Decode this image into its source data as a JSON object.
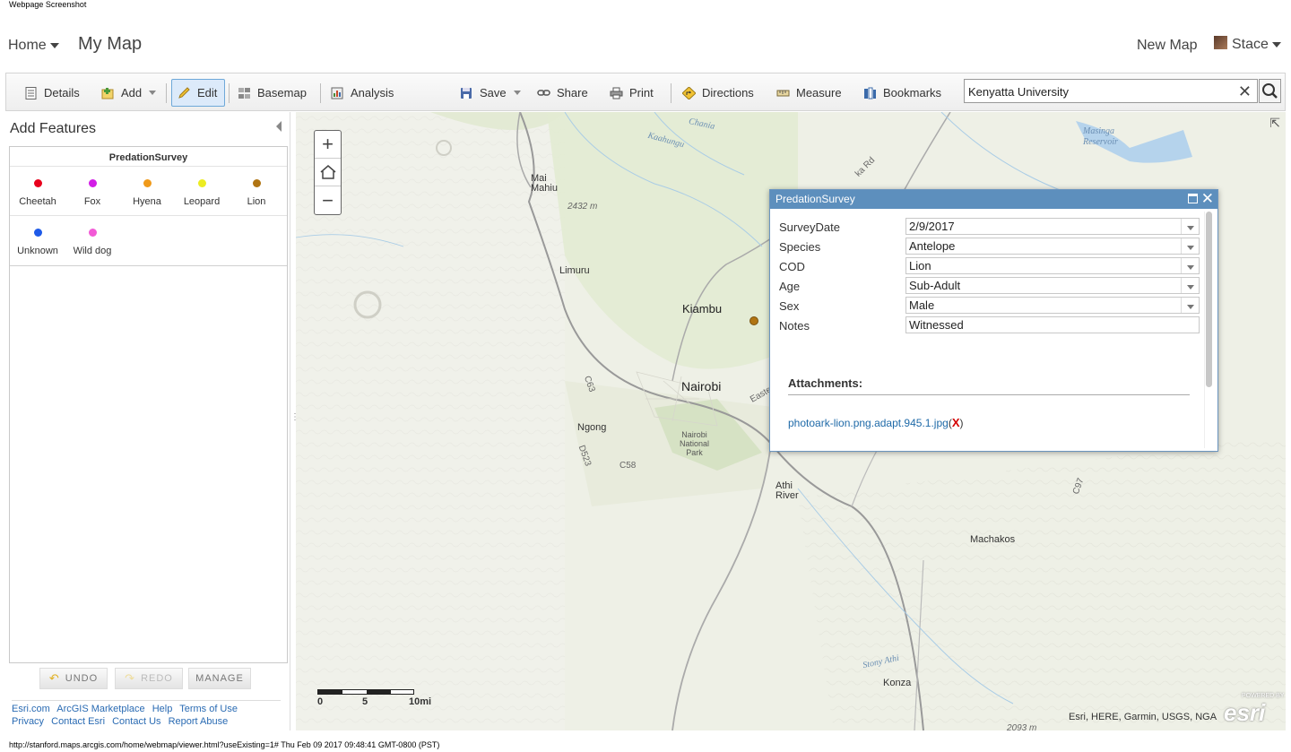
{
  "page": {
    "screenshot_title": "Webpage Screenshot",
    "status_url": "http://stanford.maps.arcgis.com/home/webmap/viewer.html?useExisting=1# Thu Feb 09 2017 09:48:41 GMT-0800 (PST)"
  },
  "header": {
    "home_label": "Home",
    "map_title": "My Map",
    "new_map_label": "New Map",
    "user_name": "Stace"
  },
  "toolbar": {
    "details": "Details",
    "add": "Add",
    "edit": "Edit",
    "basemap": "Basemap",
    "analysis": "Analysis",
    "save": "Save",
    "share": "Share",
    "print": "Print",
    "directions": "Directions",
    "measure": "Measure",
    "bookmarks": "Bookmarks",
    "search_value": "Kenyatta University",
    "clear_symbol": "✕"
  },
  "left_panel": {
    "title": "Add Features",
    "layer_name": "PredationSurvey",
    "templates": [
      {
        "label": "Cheetah",
        "color": "#e8001c"
      },
      {
        "label": "Fox",
        "color": "#d21ee6"
      },
      {
        "label": "Hyena",
        "color": "#f09a1a"
      },
      {
        "label": "Leopard",
        "color": "#ecec22"
      },
      {
        "label": "Lion",
        "color": "#b07412"
      },
      {
        "label": "Unknown",
        "color": "#1e5ae8"
      },
      {
        "label": "Wild dog",
        "color": "#f25ad6"
      }
    ],
    "buttons": {
      "undo": "UNDO",
      "redo": "REDO",
      "manage": "MANAGE"
    },
    "footer": {
      "line1": [
        "Esri.com",
        "ArcGIS Marketplace",
        "Help",
        "Terms of Use"
      ],
      "line2": [
        "Privacy",
        "Contact Esri",
        "Contact Us",
        "Report Abuse"
      ]
    }
  },
  "map": {
    "labels": {
      "kiambu": "Kiambu",
      "nairobi": "Nairobi",
      "limuru": "Limuru",
      "mai_mahiu": "Mai\nMahiu",
      "ngong": "Ngong",
      "nairobi_np": "Nairobi\nNational\nPark",
      "athi_river": "Athi\nRiver",
      "machakos": "Machakos",
      "konza": "Konza",
      "masinga": "Masinga\nReservoir",
      "chania": "Chania",
      "kaahungu": "Kaahungu",
      "stony_athi": "Stony Athi",
      "elev_2432": "2432 m",
      "elev_2093": "2093 m",
      "c63": "C63",
      "c58": "C58",
      "d523": "D523",
      "c97": "C97",
      "eastern": "Easte",
      "ka_rd": "ka Rd"
    },
    "zoom_in": "+",
    "zoom_out": "−",
    "scale": {
      "l0": "0",
      "l5": "5",
      "l10": "10mi"
    },
    "attribution": "Esri, HERE, Garmin, USGS, NGA",
    "esri_logo": "esri",
    "esri_powered": "POWERED BY"
  },
  "popup": {
    "title": "PredationSurvey",
    "fields": [
      {
        "label": "SurveyDate",
        "value": "2/9/2017"
      },
      {
        "label": "Species",
        "value": "Antelope"
      },
      {
        "label": "COD",
        "value": "Lion"
      },
      {
        "label": "Age",
        "value": "Sub-Adult"
      },
      {
        "label": "Sex",
        "value": "Male"
      },
      {
        "label": "Notes",
        "value": "Witnessed"
      }
    ],
    "attachments_label": "Attachments:",
    "attachment_name": "photoark-lion.png.adapt.945.1.jpg",
    "attachment_delete": "X",
    "paren_open": "(",
    "paren_close": ")"
  },
  "colors": {
    "accent": "#5d8fbd",
    "link": "#1f6aa8",
    "toolbar_active": "#dceafa"
  }
}
